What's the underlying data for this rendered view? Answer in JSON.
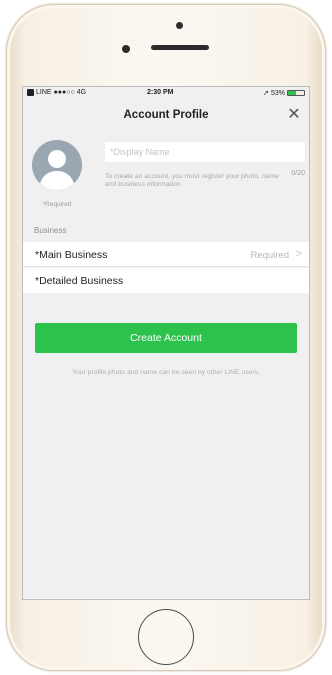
{
  "status_bar": {
    "carrier": "LINE",
    "signal": "●●●○○",
    "network": "4G",
    "time": "2:30 PM",
    "location_arrow": "➚",
    "battery_percent": "53%",
    "battery_level": 0.53,
    "battery_color": "#2dc24c"
  },
  "nav": {
    "title": "Account Profile",
    "close_label": "✕"
  },
  "profile": {
    "required_note": "*Required",
    "display_name_placeholder": "*Display Name",
    "display_name_value": "",
    "char_count": "0/20",
    "helper_text": "To create an account, you must register your photo, name and business information."
  },
  "business": {
    "section_label": "Business",
    "main_label": "*Main Business",
    "main_value": "Required",
    "main_chevron": ">",
    "detailed_label": "*Detailed Business"
  },
  "actions": {
    "create_label": "Create Account",
    "create_color": "#2dc24c"
  },
  "footnote": "Your profile photo and name can be seen by other LINE users."
}
